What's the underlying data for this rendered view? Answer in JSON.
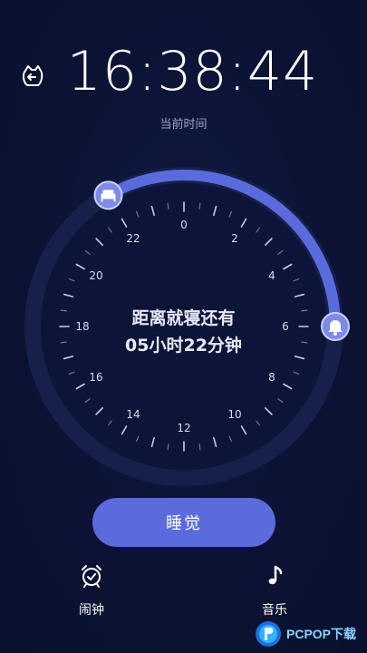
{
  "header": {
    "time": "16:38:44",
    "caption": "当前时间"
  },
  "dial": {
    "hour_labels": [
      "0",
      "2",
      "4",
      "6",
      "8",
      "10",
      "12",
      "14",
      "16",
      "18",
      "20",
      "22"
    ],
    "bedtime_hour": 22,
    "wake_hour": 6,
    "center_line1": "距离就寝还有",
    "center_line2": "05小时22分钟"
  },
  "actions": {
    "sleep_label": "睡觉"
  },
  "nav": {
    "alarm_label": "闹钟",
    "music_label": "音乐"
  },
  "watermark": {
    "text": "PCPOP下载"
  },
  "colors": {
    "background": "#0b1233",
    "accent": "#5b6bde",
    "ring": "#16204a"
  }
}
